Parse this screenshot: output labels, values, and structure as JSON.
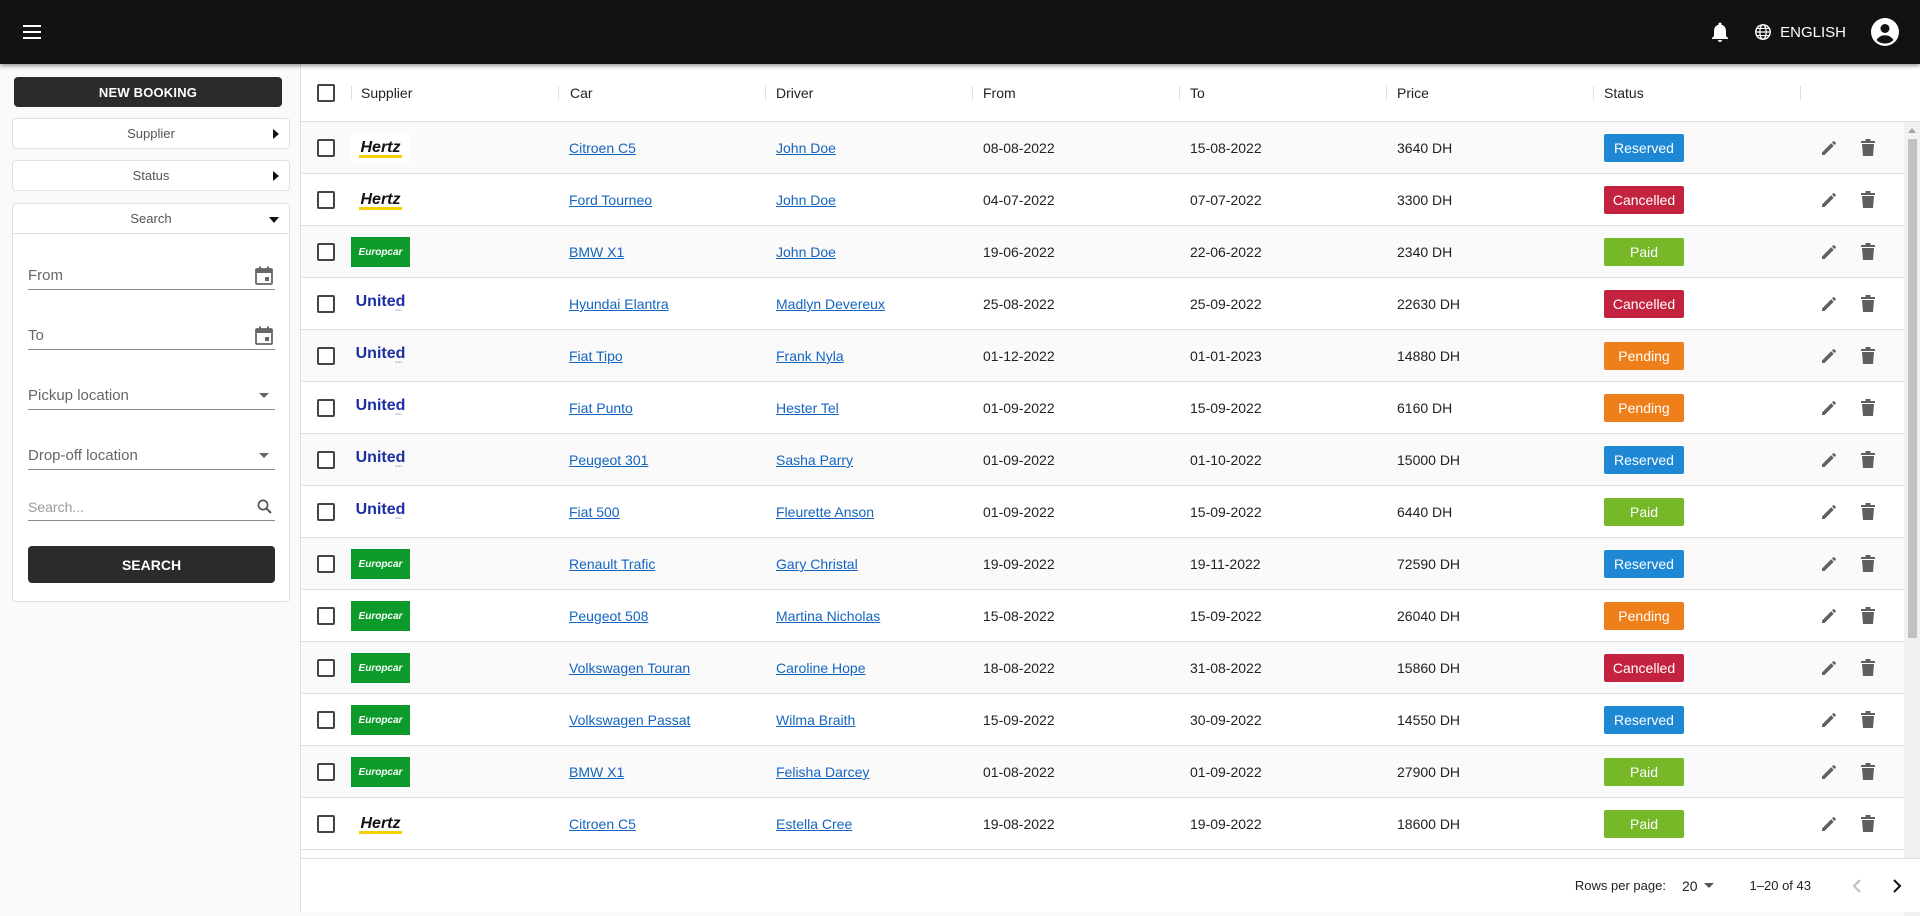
{
  "topbar": {
    "menu_icon": "hamburger-menu-icon",
    "notifications_icon": "bell-icon",
    "language_icon": "globe-icon",
    "language": "ENGLISH",
    "account_icon": "account-circle-icon",
    "background": "#121212"
  },
  "sidebar": {
    "new_booking": "NEW BOOKING",
    "supplier_filter": "Supplier",
    "status_filter": "Status",
    "search_panel": {
      "title": "Search",
      "from": "From",
      "to": "To",
      "pickup": "Pickup location",
      "dropoff": "Drop-off location",
      "search_placeholder": "Search...",
      "search_button": "SEARCH"
    }
  },
  "table": {
    "columns": {
      "supplier": "Supplier",
      "car": "Car",
      "driver": "Driver",
      "from": "From",
      "to": "To",
      "price": "Price",
      "status": "Status"
    },
    "rows": [
      {
        "supplier": "Hertz",
        "car": "Citroen C5",
        "driver": "John Doe",
        "from": "08-08-2022",
        "to": "15-08-2022",
        "price": "3640 DH",
        "status": "Reserved"
      },
      {
        "supplier": "Hertz",
        "car": "Ford Tourneo",
        "driver": "John Doe",
        "from": "04-07-2022",
        "to": "07-07-2022",
        "price": "3300 DH",
        "status": "Cancelled"
      },
      {
        "supplier": "Europcar",
        "car": "BMW X1",
        "driver": "John Doe",
        "from": "19-06-2022",
        "to": "22-06-2022",
        "price": "2340 DH",
        "status": "Paid"
      },
      {
        "supplier": "United",
        "car": "Hyundai Elantra",
        "driver": "Madlyn Devereux",
        "from": "25-08-2022",
        "to": "25-09-2022",
        "price": "22630 DH",
        "status": "Cancelled"
      },
      {
        "supplier": "United",
        "car": "Fiat Tipo",
        "driver": "Frank Nyla",
        "from": "01-12-2022",
        "to": "01-01-2023",
        "price": "14880 DH",
        "status": "Pending"
      },
      {
        "supplier": "United",
        "car": "Fiat Punto",
        "driver": "Hester Tel",
        "from": "01-09-2022",
        "to": "15-09-2022",
        "price": "6160 DH",
        "status": "Pending"
      },
      {
        "supplier": "United",
        "car": "Peugeot 301",
        "driver": "Sasha Parry",
        "from": "01-09-2022",
        "to": "01-10-2022",
        "price": "15000 DH",
        "status": "Reserved"
      },
      {
        "supplier": "United",
        "car": "Fiat 500",
        "driver": "Fleurette Anson",
        "from": "01-09-2022",
        "to": "15-09-2022",
        "price": "6440 DH",
        "status": "Paid"
      },
      {
        "supplier": "Europcar",
        "car": "Renault Trafic",
        "driver": "Gary Christal",
        "from": "19-09-2022",
        "to": "19-11-2022",
        "price": "72590 DH",
        "status": "Reserved"
      },
      {
        "supplier": "Europcar",
        "car": "Peugeot 508",
        "driver": "Martina Nicholas",
        "from": "15-08-2022",
        "to": "15-09-2022",
        "price": "26040 DH",
        "status": "Pending"
      },
      {
        "supplier": "Europcar",
        "car": "Volkswagen Touran",
        "driver": "Caroline Hope",
        "from": "18-08-2022",
        "to": "31-08-2022",
        "price": "15860 DH",
        "status": "Cancelled"
      },
      {
        "supplier": "Europcar",
        "car": "Volkswagen Passat",
        "driver": "Wilma Braith",
        "from": "15-09-2022",
        "to": "30-09-2022",
        "price": "14550 DH",
        "status": "Reserved"
      },
      {
        "supplier": "Europcar",
        "car": "BMW X1",
        "driver": "Felisha Darcey",
        "from": "01-08-2022",
        "to": "01-09-2022",
        "price": "27900 DH",
        "status": "Paid"
      },
      {
        "supplier": "Hertz",
        "car": "Citroen C5",
        "driver": "Estella Cree",
        "from": "19-08-2022",
        "to": "19-09-2022",
        "price": "18600 DH",
        "status": "Paid"
      }
    ],
    "status_colors": {
      "Reserved": "#1e88d4",
      "Cancelled": "#c4233f",
      "Paid": "#77b829",
      "Pending": "#ef7f1a"
    },
    "supplier_logo_text": {
      "Hertz": "Hertz",
      "Europcar": "Europcar",
      "United": "United"
    }
  },
  "pagination": {
    "rows_per_page_label": "Rows per page:",
    "rows_per_page": "20",
    "range": "1–20 of 43",
    "prev_icon": "chevron-left-icon",
    "next_icon": "chevron-right-icon"
  }
}
